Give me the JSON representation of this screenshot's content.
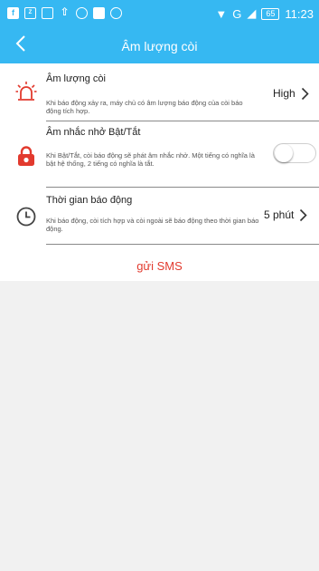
{
  "status_bar": {
    "time": "11:23",
    "battery": "65",
    "network": "G"
  },
  "app_bar": {
    "title": "Âm lượng còi"
  },
  "settings": [
    {
      "title": "Âm lượng còi",
      "description": "Khi báo động xảy ra, máy chủ có âm lượng báo động của còi báo động tích hợp.",
      "value": "High",
      "icon": "siren-icon"
    },
    {
      "title": "Âm nhắc nhở Bật/Tắt",
      "description": "Khi Bật/Tắt, còi báo động sẽ phát âm nhắc nhở. Một tiếng có nghĩa là bật hệ thống, 2 tiếng có nghĩa là tắt.",
      "toggle_on": false,
      "icon": "lock-icon"
    },
    {
      "title": "Thời gian báo động",
      "description": "Khi báo động, còi tích hợp và còi ngoài sẽ báo động theo thời gian báo động.",
      "value": "5 phút",
      "icon": "clock-icon"
    }
  ],
  "sms_button": "gửi SMS",
  "colors": {
    "primary": "#36b8f2",
    "alarm_red": "#e23a2e",
    "background": "#f1f1f1"
  }
}
